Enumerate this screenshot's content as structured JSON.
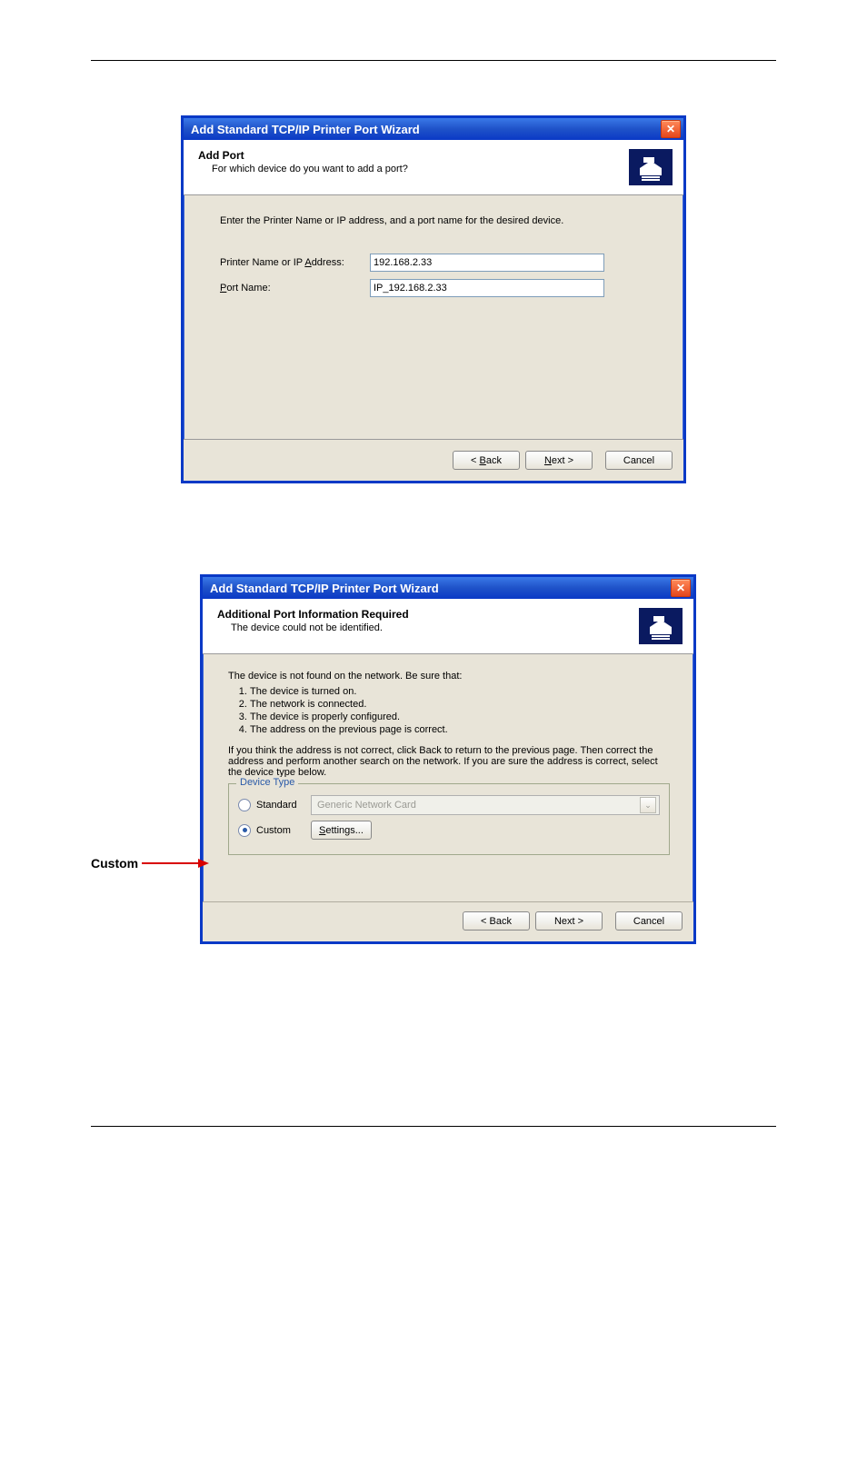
{
  "dialog1": {
    "title": "Add Standard TCP/IP Printer Port Wizard",
    "header_title": "Add Port",
    "header_sub": "For which device do you want to add a port?",
    "instruction": "Enter the Printer Name or IP address, and a port name for the desired device.",
    "label_ip_pre": "Printer Name or IP ",
    "label_ip_u": "A",
    "label_ip_post": "ddress:",
    "value_ip": "192.168.2.33",
    "label_port_u": "P",
    "label_port_post": "ort Name:",
    "value_port": "IP_192.168.2.33",
    "btn_back_pre": "< ",
    "btn_back_u": "B",
    "btn_back_post": "ack",
    "btn_next_u": "N",
    "btn_next_post": "ext >",
    "btn_cancel": "Cancel"
  },
  "dialog2": {
    "title": "Add Standard TCP/IP Printer Port Wizard",
    "header_title": "Additional Port Information Required",
    "header_sub": "The device could not be identified.",
    "intro": "The device is not found on the network.  Be sure that:",
    "items": {
      "0": "The device is turned on.",
      "1": "The network is connected.",
      "2": "The device is properly configured.",
      "3": "The address on the previous page is correct."
    },
    "para2": "If you think the address is not correct, click Back to return to the previous page.  Then correct the address and perform another search on the network.  If you are sure the address is correct, select the device type below.",
    "legend": "Device Type",
    "radio_standard": "Standard",
    "combo_value": "Generic Network Card",
    "radio_custom": "Custom",
    "btn_settings": "Settings...",
    "btn_back": "< Back",
    "btn_next": "Next >",
    "btn_cancel": "Cancel"
  },
  "callout": {
    "label": "Custom"
  }
}
